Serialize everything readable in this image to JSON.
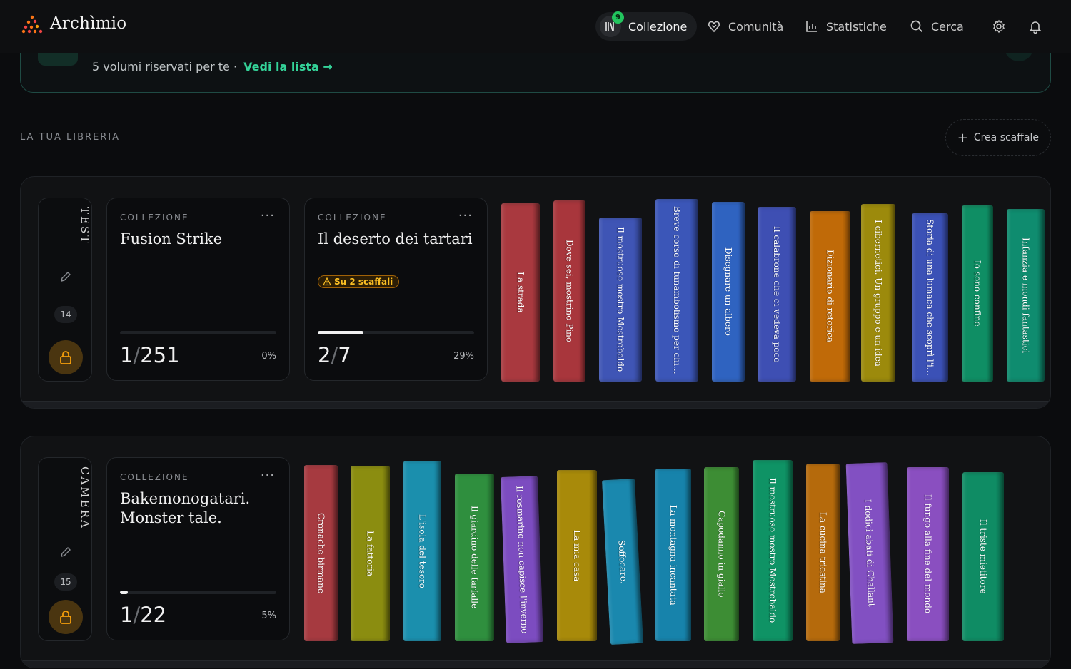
{
  "app": {
    "name": "Archìmio"
  },
  "nav": {
    "collection": {
      "label": "Collezione",
      "badge": "9"
    },
    "community": {
      "label": "Comunità"
    },
    "stats": {
      "label": "Statistiche"
    },
    "search": {
      "label": "Cerca"
    }
  },
  "reserved": {
    "text": "5 volumi riservati per te",
    "separator": "·",
    "link": "Vedi la lista →"
  },
  "library": {
    "label": "LA TUA LIBRERIA",
    "create_shelf": "Crea scaffale"
  },
  "shelves": [
    {
      "name": "TEST",
      "count": "14",
      "cards": [
        {
          "label": "COLLEZIONE",
          "more": "···",
          "title": "Fusion Strike",
          "read": "1",
          "total": "251",
          "percent": "0%",
          "progress": 0
        },
        {
          "label": "COLLEZIONE",
          "more": "···",
          "title": "Il deserto dei tartari",
          "warning": "Su 2 scaffali",
          "read": "2",
          "total": "7",
          "percent": "29%",
          "progress": 0.29
        }
      ],
      "books": [
        {
          "title": "La strada",
          "color": "#a9393f"
        },
        {
          "title": "Dove sei, mostrino Pino",
          "color": "#a8363c"
        },
        {
          "title": "Il mostruoso mostro Mostrobaldo",
          "color": "#3f55b5"
        },
        {
          "title": "Breve corso di funambolismo per chi…",
          "color": "#3b56b8"
        },
        {
          "title": "Disegnare un albero",
          "color": "#2f63c0"
        },
        {
          "title": "Il calabrone che ci vedeva poco",
          "color": "#3e4fb3"
        },
        {
          "title": "Dizionario di retorica",
          "color": "#c06a08"
        },
        {
          "title": "I cibernetici. Un gruppo e un'idea",
          "color": "#9c8a0c"
        },
        {
          "title": "Storia di una lumaca che scoprì l'im…",
          "color": "#3b51b6"
        },
        {
          "title": "Io sono confine",
          "color": "#0f8e64"
        },
        {
          "title": "Infanzia e mondi fantastici",
          "color": "#0f8c6f"
        }
      ]
    },
    {
      "name": "CAMERA",
      "count": "15",
      "cards": [
        {
          "label": "COLLEZIONE",
          "more": "···",
          "title": "Bakemonogatari. Monster tale.",
          "read": "1",
          "total": "22",
          "percent": "5%",
          "progress": 0.05
        }
      ],
      "books": [
        {
          "title": "Cronache birmane",
          "color": "#a63a40"
        },
        {
          "title": "La fattoria",
          "color": "#8b8d10"
        },
        {
          "title": "L'isola del tesoro",
          "color": "#1b8fad"
        },
        {
          "title": "Il giardino delle farfalle",
          "color": "#2f8f3e"
        },
        {
          "title": "Il rosmarino non capisce l'inverno",
          "color": "#7c4cc0"
        },
        {
          "title": "La mia casa",
          "color": "#a88a0a"
        },
        {
          "title": "Soffocare.",
          "color": "#1a88ae"
        },
        {
          "title": "La montagna incantata",
          "color": "#1783ab"
        },
        {
          "title": "Capodanno in giallo",
          "color": "#3d8d34"
        },
        {
          "title": "Il mostruoso mostro Mostrobaldo",
          "color": "#0f9365"
        },
        {
          "title": "La cucina triestina",
          "color": "#b56a0c"
        },
        {
          "title": "I dodici abati di Challant",
          "color": "#8250c2"
        },
        {
          "title": "Il fungo alla fine del mondo",
          "color": "#8a4fc0"
        },
        {
          "title": "Il triste mietitore",
          "color": "#0f8c64"
        }
      ]
    }
  ]
}
